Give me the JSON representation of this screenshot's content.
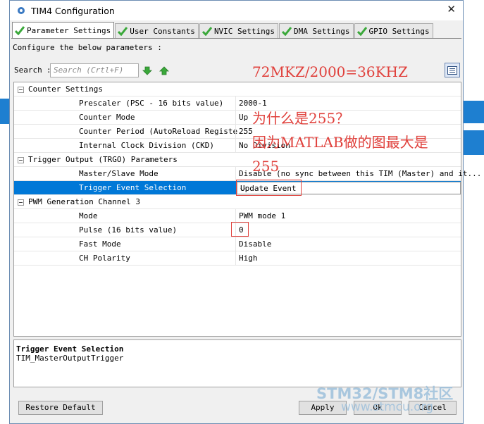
{
  "window": {
    "title": "TIM4 Configuration",
    "close_glyph": "✕"
  },
  "tabs": [
    {
      "label": "Parameter Settings",
      "active": true
    },
    {
      "label": "User Constants"
    },
    {
      "label": "NVIC Settings"
    },
    {
      "label": "DMA Settings"
    },
    {
      "label": "GPIO Settings"
    }
  ],
  "configure_text": "Configure the below parameters :",
  "search": {
    "label": "Search",
    "sep": ":",
    "placeholder": "Search (Crtl+F)"
  },
  "groups": {
    "counter": {
      "label": "Counter Settings",
      "rows": [
        {
          "name": "Prescaler (PSC - 16 bits value)",
          "value": "2000-1"
        },
        {
          "name": "Counter Mode",
          "value": "Up"
        },
        {
          "name": "Counter Period (AutoReload Registe...",
          "value": "255"
        },
        {
          "name": "Internal Clock Division (CKD)",
          "value": "No Division"
        }
      ]
    },
    "trigger": {
      "label": "Trigger Output (TRGO) Parameters",
      "rows": [
        {
          "name": "Master/Slave Mode",
          "value": "Disable (no sync between this TIM (Master) and it..."
        },
        {
          "name": "Trigger Event Selection",
          "value": "Update Event"
        }
      ]
    },
    "pwm": {
      "label": "PWM Generation Channel 3",
      "rows": [
        {
          "name": "Mode",
          "value": "PWM mode 1"
        },
        {
          "name": "Pulse (16 bits value)",
          "value": "0"
        },
        {
          "name": "Fast Mode",
          "value": "Disable"
        },
        {
          "name": "CH Polarity",
          "value": "High"
        }
      ]
    }
  },
  "description": {
    "title": "Trigger Event Selection",
    "text": "TIM_MasterOutputTrigger"
  },
  "buttons": {
    "restore": "Restore Default",
    "apply": "Apply",
    "ok": "Ok",
    "cancel": "Cancel"
  },
  "annotations": {
    "formula": "72MKZ/2000=36KHZ",
    "question": "为什么是255？",
    "answer_line1": "因为MATLAB做的图最大是",
    "answer_line2": "255"
  },
  "watermark": {
    "brand": "STM32/STM8社区",
    "url": "www.stmcu.org"
  },
  "colors": {
    "selection": "#0078d7",
    "annotation": "#e0413c",
    "check_green": "#3aa83a"
  }
}
